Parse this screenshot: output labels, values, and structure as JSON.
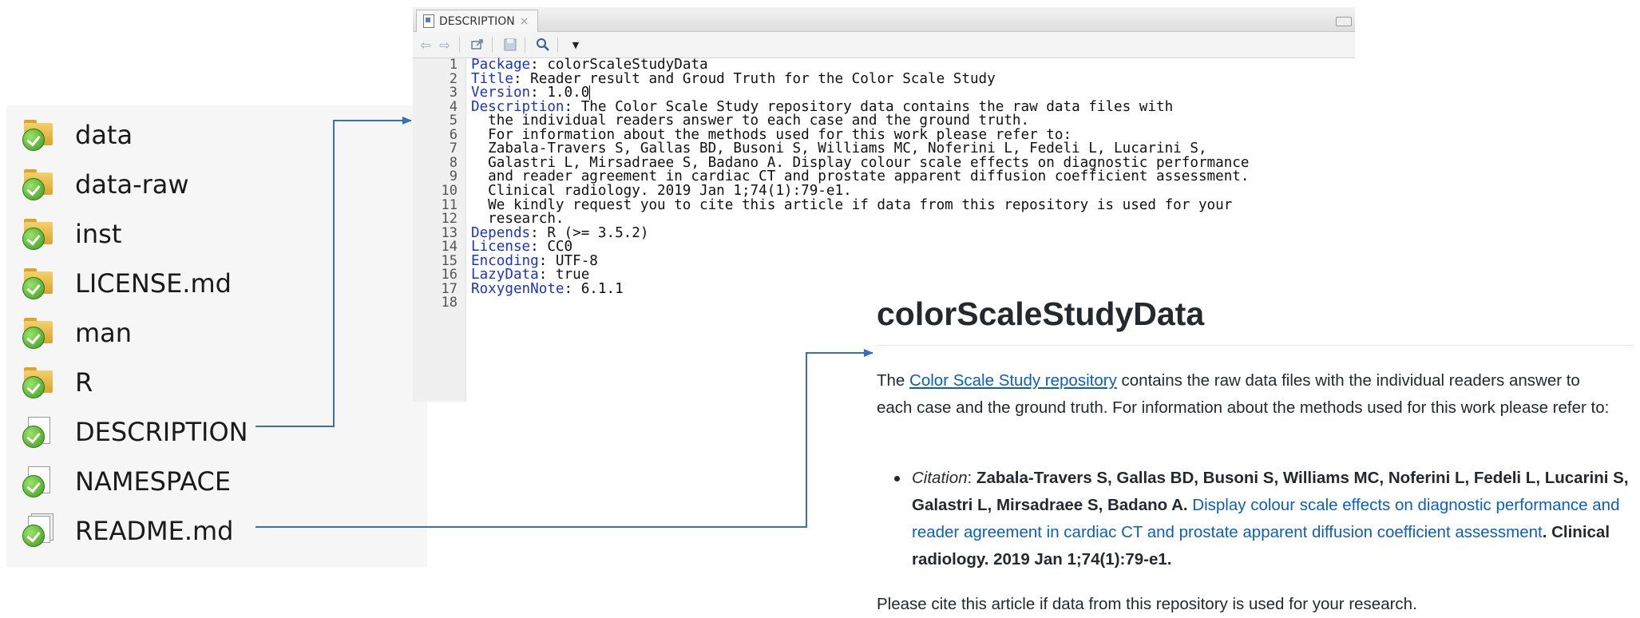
{
  "files": [
    {
      "name": "data",
      "type": "folder"
    },
    {
      "name": "data-raw",
      "type": "folder"
    },
    {
      "name": "inst",
      "type": "folder"
    },
    {
      "name": "LICENSE.md",
      "type": "folder"
    },
    {
      "name": "man",
      "type": "folder"
    },
    {
      "name": "R",
      "type": "folder"
    },
    {
      "name": "DESCRIPTION",
      "type": "file"
    },
    {
      "name": "NAMESPACE",
      "type": "file"
    },
    {
      "name": "README.md",
      "type": "file"
    }
  ],
  "editor": {
    "tab_label": "DESCRIPTION",
    "tab_close": "×",
    "toolbar_icons": [
      "back-arrow-icon",
      "forward-arrow-icon",
      "show-in-window-icon",
      "save-icon",
      "find-icon",
      "dropdown-icon"
    ],
    "line_numbers": [
      "1",
      "2",
      "3",
      "4",
      "5",
      "6",
      "7",
      "8",
      "9",
      "10",
      "11",
      "12",
      "13",
      "14",
      "15",
      "16",
      "17",
      "18"
    ],
    "lines": [
      {
        "key": "Package",
        "value": ": colorScaleStudyData"
      },
      {
        "key": "Title",
        "value": ": Reader result and Groud Truth for the Color Scale Study"
      },
      {
        "key": "Version",
        "value": ": 1.0.0"
      },
      {
        "key": "Description",
        "value": ": The Color Scale Study repository data contains the raw data files with"
      },
      {
        "key": "",
        "value": "  the individual readers answer to each case and the ground truth."
      },
      {
        "key": "",
        "value": "  For information about the methods used for this work please refer to:"
      },
      {
        "key": "",
        "value": "  Zabala-Travers S, Gallas BD, Busoni S, Williams MC, Noferini L, Fedeli L, Lucarini S,"
      },
      {
        "key": "",
        "value": "  Galastri L, Mirsadraee S, Badano A. Display colour scale effects on diagnostic performance"
      },
      {
        "key": "",
        "value": "  and reader agreement in cardiac CT and prostate apparent diffusion coefficient assessment."
      },
      {
        "key": "",
        "value": "  Clinical radiology. 2019 Jan 1;74(1):79-e1."
      },
      {
        "key": "",
        "value": "  We kindly request you to cite this article if data from this repository is used for your"
      },
      {
        "key": "",
        "value": "  research."
      },
      {
        "key": "Depends",
        "value": ": R (>= 3.5.2)"
      },
      {
        "key": "License",
        "value": ": CC0"
      },
      {
        "key": "Encoding",
        "value": ": UTF-8"
      },
      {
        "key": "LazyData",
        "value": ": true"
      },
      {
        "key": "RoxygenNote",
        "value": ": 6.1.1"
      },
      {
        "key": "",
        "value": ""
      }
    ]
  },
  "readme": {
    "title": "colorScaleStudyData",
    "intro_prefix": "The ",
    "intro_link": "Color Scale Study repository",
    "intro_suffix": " contains the raw data files with the individual readers answer to each case and the ground truth. For information about the methods used for this work please refer to:",
    "citation_label": "Citation",
    "citation_sep": ": ",
    "citation_authors": "Zabala-Travers S, Gallas BD, Busoni S, Williams MC, Noferini L, Fedeli L, Lucarini S, Galastri L, Mirsadraee S, Badano A. ",
    "citation_link": "Display colour scale effects on diagnostic performance and reader agreement in cardiac CT and prostate apparent diffusion coefficient assessment",
    "citation_journal": ". Clinical radiology. 2019 Jan 1;74(1):79-e1.",
    "footer": "Please cite this article if data from this repository is used for your research."
  },
  "colors": {
    "key_blue": "#1a33d6",
    "link_blue": "#0a5fbf",
    "arrow_blue": "#3a6fb5"
  }
}
